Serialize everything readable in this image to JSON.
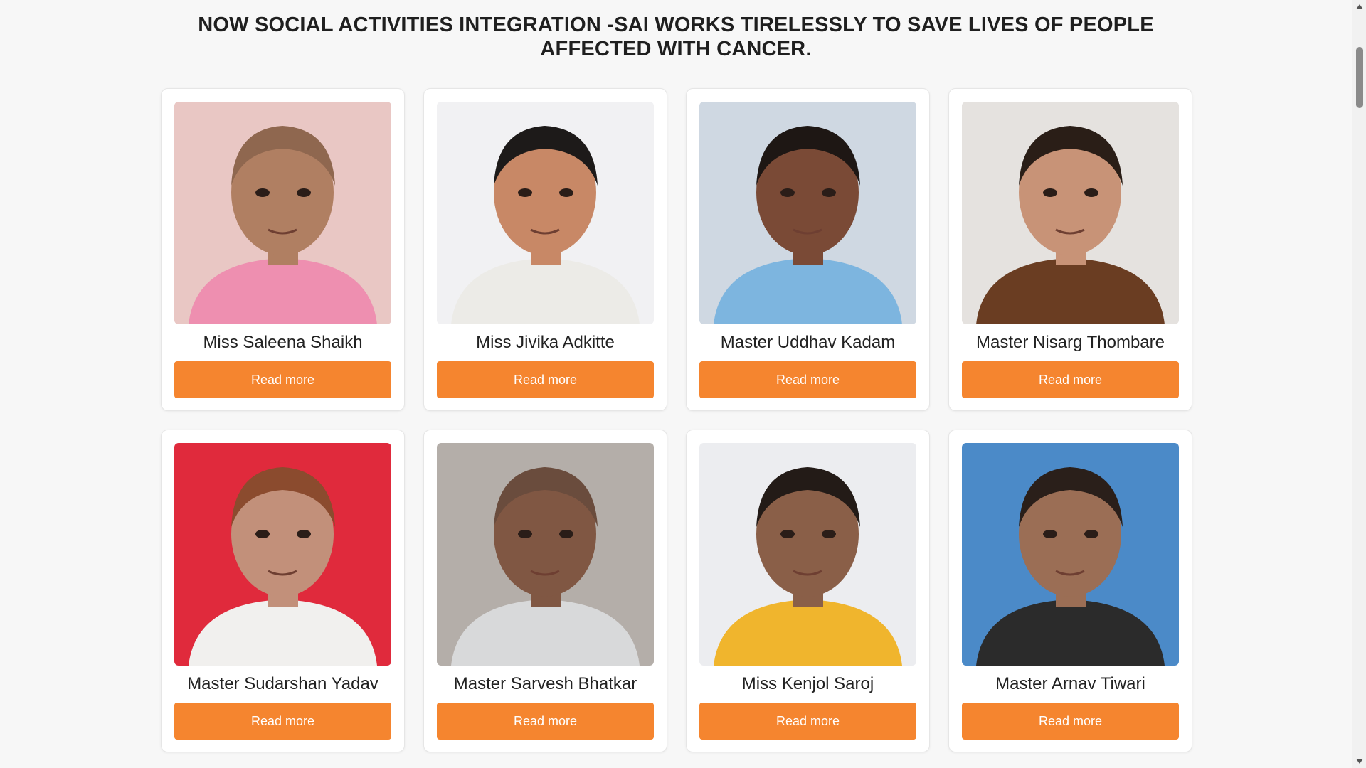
{
  "heading": "NOW SOCIAL ACTIVITIES INTEGRATION -SAI WORKS TIRELESSLY TO SAVE LIVES OF PEOPLE AFFECTED WITH CANCER.",
  "button_color": "#f5852f",
  "cards": [
    {
      "name": "Miss Saleena Shaikh",
      "button": "Read more",
      "photo_bg": "#e9c7c4",
      "skin": "#b07f62",
      "shirt": "#ee8fb0",
      "hair": "#8f674f"
    },
    {
      "name": "Miss Jivika Adkitte",
      "button": "Read more",
      "photo_bg": "#f1f1f3",
      "skin": "#c88866",
      "shirt": "#ecebe7",
      "hair": "#1d1a19"
    },
    {
      "name": "Master Uddhav Kadam",
      "button": "Read more",
      "photo_bg": "#cfd8e2",
      "skin": "#7a4a36",
      "shirt": "#7db5df",
      "hair": "#1e1714"
    },
    {
      "name": "Master Nisarg Thombare",
      "button": "Read more",
      "photo_bg": "#e5e2df",
      "skin": "#c89377",
      "shirt": "#6a3d22",
      "hair": "#2a1e17"
    },
    {
      "name": "Master Sudarshan Yadav",
      "button": "Read more",
      "photo_bg": "#e02a3c",
      "skin": "#c2907a",
      "shirt": "#f1f0ee",
      "hair": "#8b4b2e"
    },
    {
      "name": "Master Sarvesh Bhatkar",
      "button": "Read more",
      "photo_bg": "#b4aea9",
      "skin": "#805743",
      "shirt": "#d8d9da",
      "hair": "#6a4c3d"
    },
    {
      "name": "Miss Kenjol Saroj",
      "button": "Read more",
      "photo_bg": "#ecedf0",
      "skin": "#8a5f48",
      "shirt": "#f0b52d",
      "hair": "#231b17"
    },
    {
      "name": "Master Arnav Tiwari",
      "button": "Read more",
      "photo_bg": "#4b8ac8",
      "skin": "#9b6e55",
      "shirt": "#2b2b2b",
      "hair": "#2a1f1a"
    }
  ]
}
